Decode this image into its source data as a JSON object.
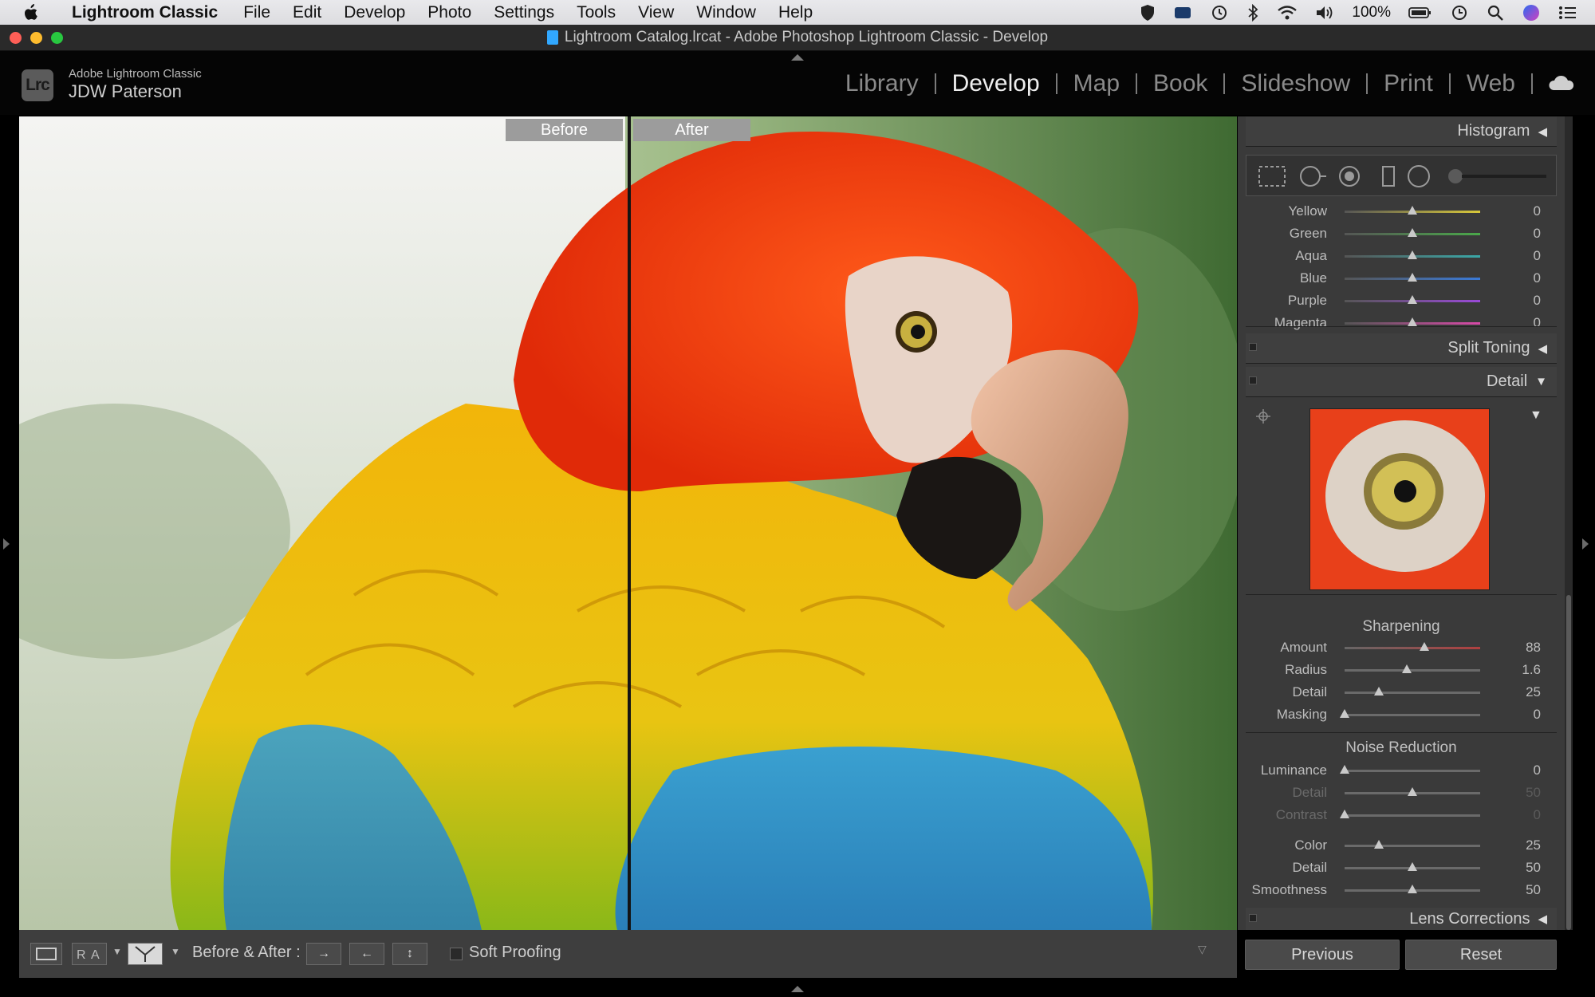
{
  "menubar": {
    "app": "Lightroom Classic",
    "items": [
      "File",
      "Edit",
      "Develop",
      "Photo",
      "Settings",
      "Tools",
      "View",
      "Window",
      "Help"
    ],
    "battery": "100%"
  },
  "window": {
    "title": "Lightroom Catalog.lrcat - Adobe Photoshop Lightroom Classic - Develop"
  },
  "identity": {
    "logo": "Lrc",
    "product": "Adobe Lightroom Classic",
    "user": "JDW Paterson"
  },
  "modules": [
    "Library",
    "Develop",
    "Map",
    "Book",
    "Slideshow",
    "Print",
    "Web"
  ],
  "active_module": "Develop",
  "view": {
    "before_label": "Before",
    "after_label": "After"
  },
  "panels": {
    "histogram": "Histogram",
    "hsl_rows": [
      {
        "label": "Yellow",
        "value": "0"
      },
      {
        "label": "Green",
        "value": "0"
      },
      {
        "label": "Aqua",
        "value": "0"
      },
      {
        "label": "Blue",
        "value": "0"
      },
      {
        "label": "Purple",
        "value": "0"
      },
      {
        "label": "Magenta",
        "value": "0"
      }
    ],
    "split_toning": "Split Toning",
    "detail": "Detail",
    "sharpening": {
      "title": "Sharpening",
      "rows": [
        {
          "label": "Amount",
          "value": "88",
          "pos": 0.59
        },
        {
          "label": "Radius",
          "value": "1.6",
          "pos": 0.46
        },
        {
          "label": "Detail",
          "value": "25",
          "pos": 0.25
        },
        {
          "label": "Masking",
          "value": "0",
          "pos": 0.0
        }
      ]
    },
    "noise": {
      "title": "Noise Reduction",
      "rows": [
        {
          "label": "Luminance",
          "value": "0",
          "pos": 0.0
        },
        {
          "label": "Detail",
          "value": "50",
          "pos": 0.5
        },
        {
          "label": "Contrast",
          "value": "0",
          "pos": 0.0
        },
        {
          "label": "Color",
          "value": "25",
          "pos": 0.25
        },
        {
          "label": "Detail",
          "value": "50",
          "pos": 0.5
        },
        {
          "label": "Smoothness",
          "value": "50",
          "pos": 0.5
        }
      ]
    },
    "lens_corrections": "Lens Corrections"
  },
  "buttons": {
    "previous": "Previous",
    "reset": "Reset"
  },
  "toolbar": {
    "before_after": "Before & After :",
    "soft_proofing": "Soft Proofing"
  },
  "colors": {
    "hsl": [
      "#d8c83a",
      "#4aa84a",
      "#3aa8a8",
      "#3a7ad8",
      "#9a4ad8",
      "#d84aa8"
    ]
  }
}
